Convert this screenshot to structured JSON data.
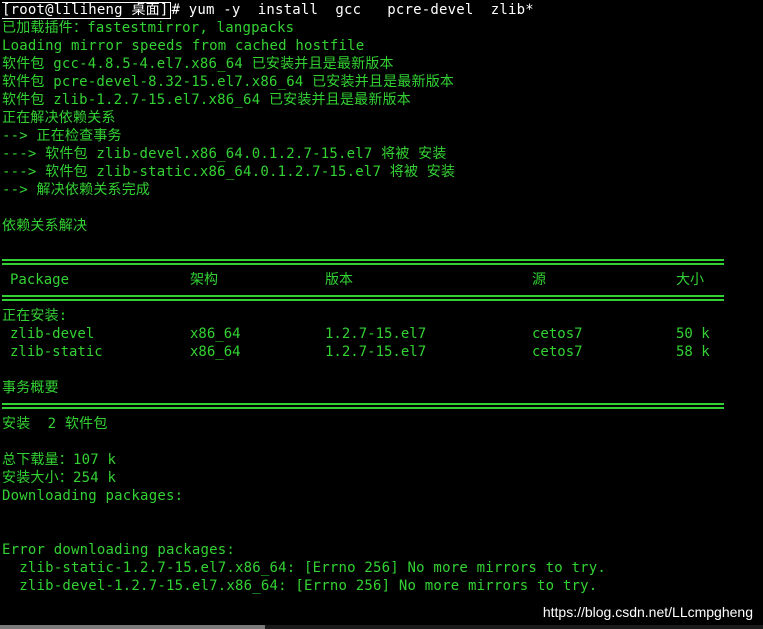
{
  "terminal": {
    "prompt": "root@liliheng 桌面",
    "command": "# yum -y  install  gcc   pcre-devel  zlib*",
    "lines": [
      "已加载插件：fastestmirror, langpacks",
      "Loading mirror speeds from cached hostfile",
      "软件包 gcc-4.8.5-4.el7.x86_64 已安装并且是最新版本",
      "软件包 pcre-devel-8.32-15.el7.x86_64 已安装并且是最新版本",
      "软件包 zlib-1.2.7-15.el7.x86_64 已安装并且是最新版本",
      "正在解决依赖关系",
      "--> 正在检查事务",
      "---> 软件包 zlib-devel.x86_64.0.1.2.7-15.el7 将被 安装",
      "---> 软件包 zlib-static.x86_64.0.1.2.7-15.el7 将被 安装",
      "--> 解决依赖关系完成"
    ],
    "resolved": "依赖关系解决",
    "table": {
      "headers": [
        "Package",
        "架构",
        "版本",
        "源",
        "大小"
      ],
      "section": "正在安装:",
      "rows": [
        [
          "zlib-devel",
          "x86_64",
          "1.2.7-15.el7",
          "cetos7",
          "50 k"
        ],
        [
          "zlib-static",
          "x86_64",
          "1.2.7-15.el7",
          "cetos7",
          "58 k"
        ]
      ]
    },
    "summary_title": "事务概要",
    "install_count": "安装  2 软件包",
    "total_download": "总下载量：107 k",
    "installed_size": "安装大小：254 k",
    "downloading": "Downloading packages:",
    "error_title": "Error downloading packages:",
    "errors": [
      "  zlib-static-1.2.7-15.el7.x86_64: [Errno 256] No more mirrors to try.",
      "  zlib-devel-1.2.7-15.el7.x86_64: [Errno 256] No more mirrors to try."
    ]
  },
  "watermark": "https://blog.csdn.net/LLcmpgheng",
  "colors": {
    "background": "#000000",
    "text": "#33d233",
    "prompt": "#ffffff"
  }
}
